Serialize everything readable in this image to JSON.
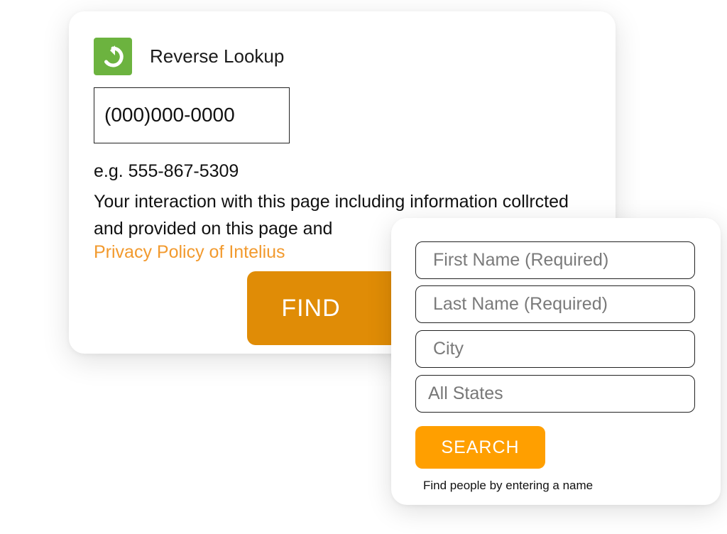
{
  "reverse_lookup": {
    "logo_icon": "refresh-arrow-icon",
    "title": "Reverse Lookup",
    "phone_value": "(000)000-0000",
    "example": "e.g. 555-867-5309",
    "disclaimer": "Your interaction with this page including information collrcted and provided on this page and",
    "privacy_link": "Privacy Policy of Intelius",
    "find_label": "FIND"
  },
  "name_search": {
    "first_name_placeholder": "First Name (Required)",
    "last_name_placeholder": "Last Name (Required)",
    "city_placeholder": "City",
    "state_value": "All States",
    "search_label": "SEARCH",
    "hint": "Find people by entering a name"
  },
  "colors": {
    "logo_green": "#6cb33f",
    "find_orange": "#e08c06",
    "search_orange": "#ff9f00",
    "link_orange": "#f29a2e"
  }
}
